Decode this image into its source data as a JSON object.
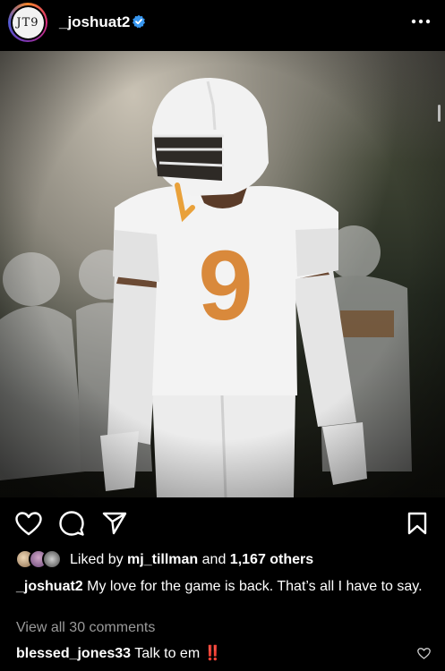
{
  "header": {
    "avatar_text": "JT9",
    "username": "_joshuat2"
  },
  "icons": {
    "verified": "verified-badge-icon",
    "more": "more-options-icon",
    "like": "heart-icon",
    "comment": "comment-bubble-icon",
    "share": "send-paper-plane-icon",
    "save": "bookmark-icon",
    "comment_like": "small-heart-icon"
  },
  "colors": {
    "verified_blue": "#3897f0",
    "jersey_orange": "#d9893b",
    "alert_red": "#e32b2b"
  },
  "post": {
    "jersey_number": "9",
    "likes": {
      "prefix": "Liked by",
      "user": "mj_tillman",
      "and": "and",
      "others": "1,167 others"
    },
    "caption": {
      "user": "_joshuat2",
      "text": "My love for the game is back. That’s all I have to say."
    },
    "view_comments": "View all 30 comments",
    "top_comment": {
      "user": "blessed_jones33",
      "text": "Talk to em",
      "emoji": "‼️"
    }
  }
}
